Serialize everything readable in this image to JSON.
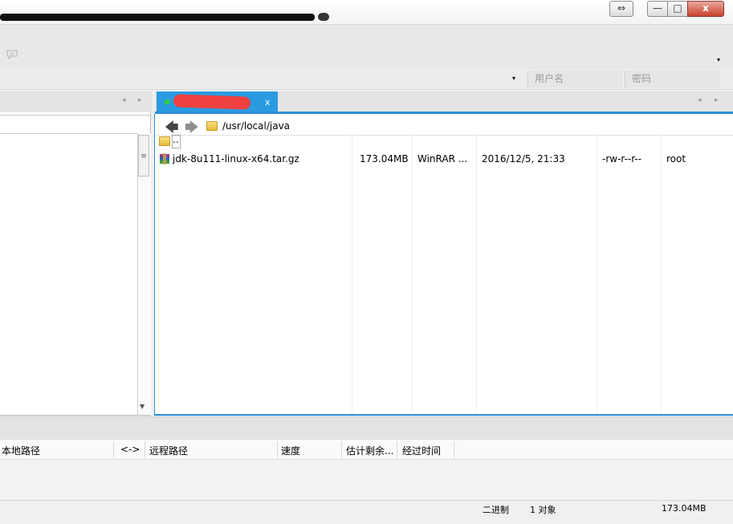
{
  "window": {
    "restore_symbol": "⇔",
    "minimize_symbol": "—",
    "maximize_symbol": "□",
    "close_symbol": "x"
  },
  "toolbar": {
    "chat_icon": "speech-bubble-icon",
    "dropdown_symbol": "▾"
  },
  "connection": {
    "host_dropdown_symbol": "▾",
    "username_placeholder": "用户名",
    "password_placeholder": "密码"
  },
  "tabs": {
    "arrow_left": "◂",
    "arrow_right": "▸",
    "remote_tab_close": "x"
  },
  "remote": {
    "path": "/usr/local/java",
    "parent_label": "..",
    "files": [
      {
        "name": "jdk-8u111-linux-x64.tar.gz",
        "size": "173.04MB",
        "type": "WinRAR ...",
        "modified": "2016/12/5, 21:33",
        "permissions": "-rw-r--r--",
        "owner": "root"
      }
    ]
  },
  "transfer": {
    "columns": [
      "本地路径",
      "<->",
      "远程路径",
      "速度",
      "估计剩余...",
      "经过时间"
    ]
  },
  "status": {
    "mode": "二进制",
    "count": "1 对象",
    "size": "173.04MB"
  },
  "colors": {
    "accent": "#2a9be0",
    "active_dot": "#2ecc40",
    "redaction": "#f04040"
  }
}
